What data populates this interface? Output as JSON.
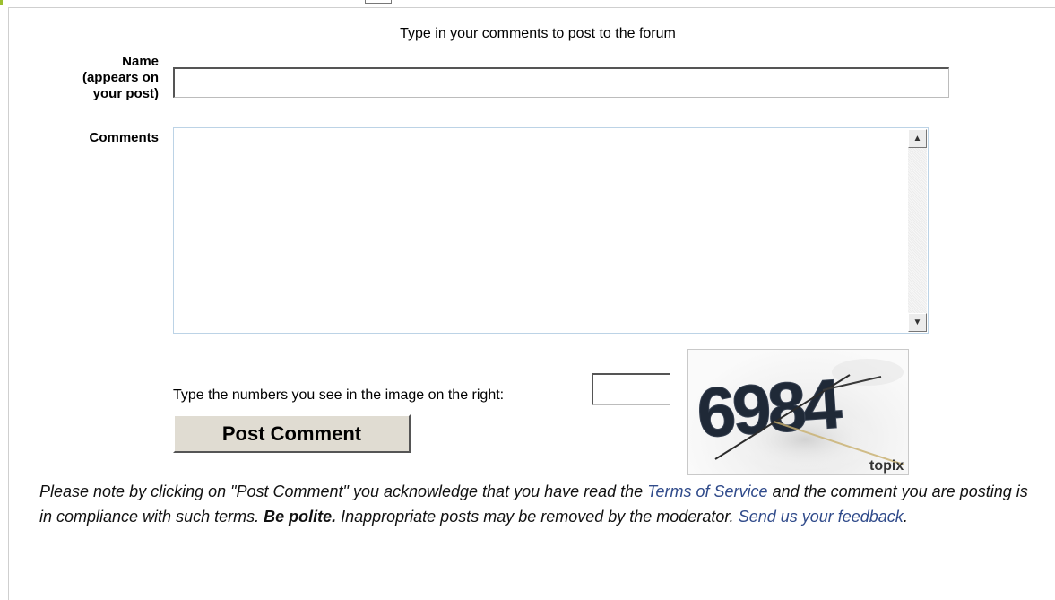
{
  "form": {
    "intro_text": "Type in your comments to post to the forum",
    "name_label_line1": "Name",
    "name_label_line2": "(appears on",
    "name_label_line3": "your post)",
    "name_value": "",
    "comments_label": "Comments",
    "comments_value": ""
  },
  "captcha": {
    "prompt": "Type the numbers you see in the image on the right:",
    "input_value": "",
    "image_text": "6984",
    "image_brand": "topix"
  },
  "actions": {
    "post_label": "Post Comment"
  },
  "notice": {
    "text_before_terms": "Please note by clicking on \"Post Comment\" you acknowledge that you have read the ",
    "terms_link": "Terms of Service",
    "text_after_terms": " and the comment you are posting is in compliance with such terms. ",
    "be_polite": "Be polite.",
    "text_after_polite": " Inappropriate posts may be removed by the moderator. ",
    "feedback_link": "Send us your feedback",
    "end": "."
  },
  "colors": {
    "link": "#2f4a8a",
    "accent": "#9cbf2f",
    "button_face": "#e0dcd2"
  }
}
